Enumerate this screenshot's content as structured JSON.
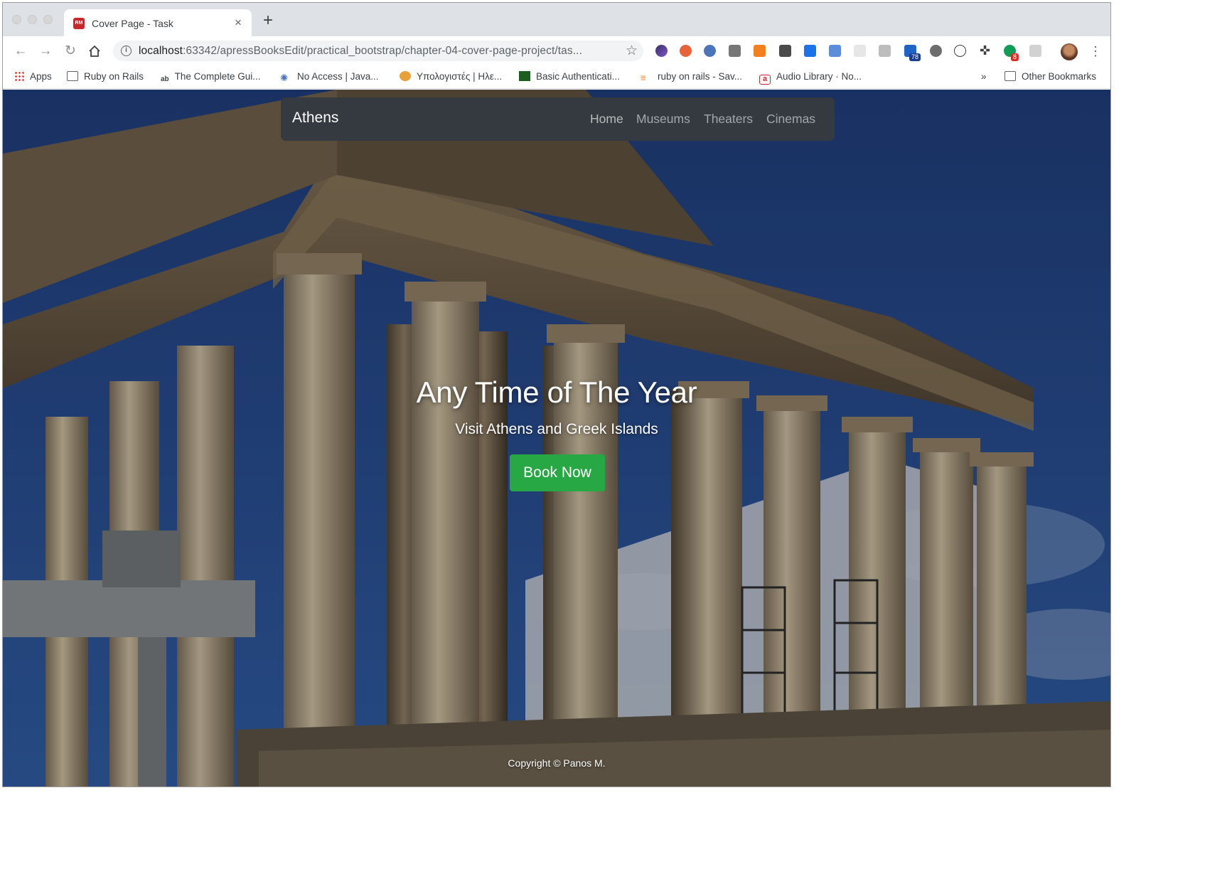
{
  "browser": {
    "tab_title": "Cover Page - Task",
    "tab_favicon_text": "RM",
    "url_host": "localhost",
    "url_rest": ":63342/apressBooksEdit/practical_bootstrap/chapter-04-cover-page-project/tas...",
    "extension_badges": [
      "78",
      "8"
    ],
    "bookmarks": [
      {
        "label": "Apps",
        "icon": "apps-grid-icon"
      },
      {
        "label": "Ruby on Rails",
        "icon": "folder-icon"
      },
      {
        "label": "The Complete Gui...",
        "icon": "ab-icon"
      },
      {
        "label": "No Access | Java...",
        "icon": "java-icon"
      },
      {
        "label": "Υπολογιστές | Ηλε...",
        "icon": "balloon-icon"
      },
      {
        "label": "Basic Authenticati...",
        "icon": "green-cube-icon"
      },
      {
        "label": "ruby on rails - Sav...",
        "icon": "stackoverflow-icon"
      },
      {
        "label": "Audio Library · No...",
        "icon": "amazon-a-icon"
      }
    ],
    "bookmarks_overflow": "»",
    "other_bookmarks": "Other Bookmarks"
  },
  "page": {
    "brand": "Athens",
    "nav": [
      "Home",
      "Museums",
      "Theaters",
      "Cinemas"
    ],
    "title": "Any Time of The Year",
    "subtitle": "Visit Athens and Greek Islands",
    "cta": "Book Now",
    "footer": "Copyright © Panos M."
  },
  "colors": {
    "navbar_bg": "#343a40",
    "cta_bg": "#28a745",
    "sky": "#274a8c"
  }
}
